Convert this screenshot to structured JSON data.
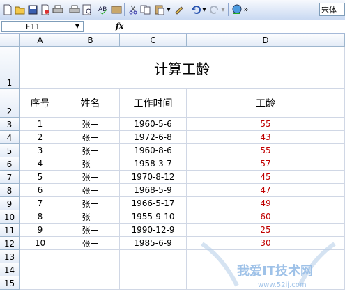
{
  "toolbar": {
    "icons": [
      "new-icon",
      "open-icon",
      "save-icon",
      "permission-icon",
      "print-icon",
      "print-preview-icon",
      "spelling-icon",
      "research-icon",
      "cut-icon",
      "copy-icon",
      "paste-icon",
      "format-painter-icon",
      "undo-icon",
      "redo-icon",
      "hyperlink-icon"
    ],
    "font_name": "宋体"
  },
  "formula_bar": {
    "name_box": "F11",
    "fx_label": "fx",
    "content": ""
  },
  "columns": [
    "A",
    "B",
    "C",
    "D"
  ],
  "rows": [
    "1",
    "2",
    "3",
    "4",
    "5",
    "6",
    "7",
    "8",
    "9",
    "10",
    "11",
    "12",
    "13",
    "14",
    "15"
  ],
  "sheet": {
    "title": "计算工龄",
    "headers": {
      "seq": "序号",
      "name": "姓名",
      "start": "工作时间",
      "years": "工龄"
    },
    "records": [
      {
        "seq": "1",
        "name": "张一",
        "start": "1960-5-6",
        "years": "55"
      },
      {
        "seq": "2",
        "name": "张一",
        "start": "1972-6-8",
        "years": "43"
      },
      {
        "seq": "3",
        "name": "张一",
        "start": "1960-8-6",
        "years": "55"
      },
      {
        "seq": "4",
        "name": "张一",
        "start": "1958-3-7",
        "years": "57"
      },
      {
        "seq": "5",
        "name": "张一",
        "start": "1970-8-12",
        "years": "45"
      },
      {
        "seq": "6",
        "name": "张一",
        "start": "1968-5-9",
        "years": "47"
      },
      {
        "seq": "7",
        "name": "张一",
        "start": "1966-5-17",
        "years": "49"
      },
      {
        "seq": "8",
        "name": "张一",
        "start": "1955-9-10",
        "years": "60"
      },
      {
        "seq": "9",
        "name": "张一",
        "start": "1990-12-9",
        "years": "25"
      },
      {
        "seq": "10",
        "name": "张一",
        "start": "1985-6-9",
        "years": "30"
      }
    ]
  },
  "colors": {
    "years_text": "#c00000",
    "gridline": "#d0d7e5",
    "header_border": "#9eb6ce"
  },
  "watermark": {
    "text": "我爱IT技术网",
    "url": "www.52ij.com"
  }
}
